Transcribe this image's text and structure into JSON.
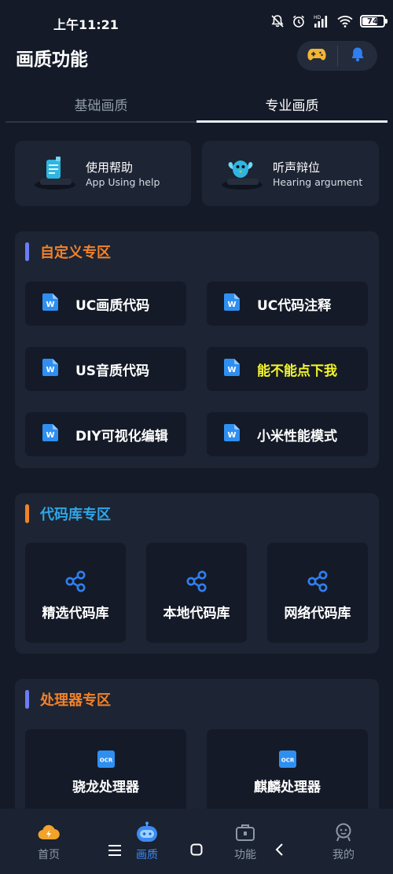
{
  "status_bar": {
    "time": "上午11:21",
    "battery_level": "74",
    "battery_fraction": 0.74,
    "icons": [
      "mute-icon",
      "alarm-icon",
      "hd-signal-icon",
      "wifi-icon",
      "battery-icon"
    ]
  },
  "header": {
    "title": "画质功能",
    "actions": [
      "gamepad-icon",
      "bell-icon"
    ]
  },
  "tabs": [
    {
      "label": "基础画质",
      "active": false
    },
    {
      "label": "专业画质",
      "active": true
    }
  ],
  "help_cards": [
    {
      "title": "使用帮助",
      "subtitle": "App Using help",
      "icon": "document-icon"
    },
    {
      "title": "听声辩位",
      "subtitle": "Hearing argument",
      "icon": "bird-icon"
    }
  ],
  "sections": {
    "custom": {
      "title": "自定义专区",
      "title_color": "#f0822a",
      "bar_color": "#6b7df2",
      "items": [
        {
          "label": "UC画质代码",
          "highlight": false
        },
        {
          "label": "UC代码注释",
          "highlight": false
        },
        {
          "label": "US音质代码",
          "highlight": false
        },
        {
          "label": "能不能点下我",
          "highlight": true
        },
        {
          "label": "DIY可视化编辑",
          "highlight": false
        },
        {
          "label": "小米性能模式",
          "highlight": false
        }
      ]
    },
    "code_library": {
      "title": "代码库专区",
      "title_color": "#2ea7e8",
      "bar_color": "#f0822a",
      "items": [
        {
          "label": "精选代码库"
        },
        {
          "label": "本地代码库"
        },
        {
          "label": "网络代码库"
        }
      ]
    },
    "processor": {
      "title": "处理器专区",
      "title_color": "#f0822a",
      "bar_color": "#6b7df2",
      "items": [
        {
          "label": "骁龙处理器",
          "icon_text": "OCR"
        },
        {
          "label": "麒麟处理器",
          "icon_text": "OCR"
        }
      ]
    }
  },
  "bottom_nav": {
    "items": [
      {
        "label": "首页",
        "icon": "home-cloud-icon",
        "active": false
      },
      {
        "label": "画质",
        "icon": "robot-icon",
        "active": true
      },
      {
        "label": "功能",
        "icon": "toolbox-icon",
        "active": false
      },
      {
        "label": "我的",
        "icon": "profile-icon",
        "active": false
      }
    ],
    "system_buttons": [
      "menu-icon",
      "home-square-icon",
      "back-icon"
    ]
  },
  "colors": {
    "background": "#141a27",
    "card": "#1d2433",
    "accent_blue": "#3d8bf2",
    "highlight_yellow": "#f4f52a"
  }
}
